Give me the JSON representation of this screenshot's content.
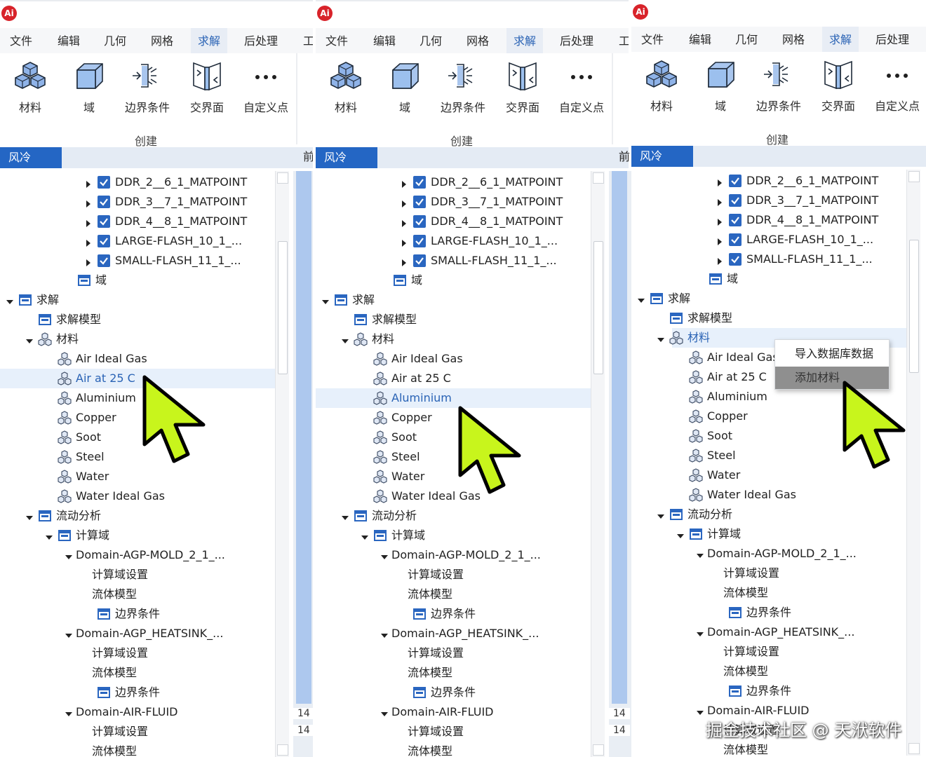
{
  "logo_text": "Ai",
  "menu": [
    "文件",
    "编辑",
    "几何",
    "网格",
    "求解",
    "后处理",
    "工"
  ],
  "active_menu": "求解",
  "ribbon": {
    "buttons": [
      {
        "label": "材料",
        "icon": "material-cubes-icon"
      },
      {
        "label": "域",
        "icon": "domain-box-icon"
      },
      {
        "label": "边界条件",
        "icon": "boundary-condition-icon"
      },
      {
        "label": "交界面",
        "icon": "interface-icon"
      },
      {
        "label": "自定义点",
        "icon": "more-dots-icon"
      }
    ],
    "group_label": "创建"
  },
  "doc_tab": "风冷",
  "side_label": "前",
  "side_numbers": [
    "14",
    "14"
  ],
  "tree": [
    {
      "indent": 4,
      "arrow": "right",
      "icon": "checkbox",
      "text": "DDR_2__6_1_MATPOINT"
    },
    {
      "indent": 4,
      "arrow": "right",
      "icon": "checkbox",
      "text": "DDR_3__7_1_MATPOINT"
    },
    {
      "indent": 4,
      "arrow": "right",
      "icon": "checkbox",
      "text": "DDR_4__8_1_MATPOINT"
    },
    {
      "indent": 4,
      "arrow": "right",
      "icon": "checkbox",
      "text": "LARGE-FLASH_10_1_..."
    },
    {
      "indent": 4,
      "arrow": "right",
      "icon": "checkbox",
      "text": "SMALL-FLASH_11_1_..."
    },
    {
      "indent": 3,
      "arrow": "none",
      "icon": "folder",
      "text": "域"
    },
    {
      "indent": 0,
      "arrow": "down",
      "icon": "folder",
      "text": "求解"
    },
    {
      "indent": 1,
      "arrow": "none",
      "icon": "folder",
      "text": "求解模型"
    },
    {
      "indent": 1,
      "arrow": "down",
      "icon": "material",
      "text": "材料",
      "key": "materials"
    },
    {
      "indent": 2,
      "arrow": "none",
      "icon": "material",
      "text": "Air Ideal Gas"
    },
    {
      "indent": 2,
      "arrow": "none",
      "icon": "material",
      "text": "Air at 25 C",
      "key": "air25"
    },
    {
      "indent": 2,
      "arrow": "none",
      "icon": "material",
      "text": "Aluminium",
      "key": "aluminium"
    },
    {
      "indent": 2,
      "arrow": "none",
      "icon": "material",
      "text": "Copper"
    },
    {
      "indent": 2,
      "arrow": "none",
      "icon": "material",
      "text": "Soot"
    },
    {
      "indent": 2,
      "arrow": "none",
      "icon": "material",
      "text": "Steel"
    },
    {
      "indent": 2,
      "arrow": "none",
      "icon": "material",
      "text": "Water"
    },
    {
      "indent": 2,
      "arrow": "none",
      "icon": "material",
      "text": "Water Ideal Gas"
    },
    {
      "indent": 1,
      "arrow": "down",
      "icon": "folder",
      "text": "流动分析"
    },
    {
      "indent": 2,
      "arrow": "down",
      "icon": "folder",
      "text": "计算域"
    },
    {
      "indent": 3,
      "arrow": "down",
      "icon": "none",
      "text": "Domain-AGP-MOLD_2_1_..."
    },
    {
      "indent": 4,
      "arrow": "none",
      "icon": "none",
      "text": "计算域设置"
    },
    {
      "indent": 4,
      "arrow": "none",
      "icon": "none",
      "text": "流体模型"
    },
    {
      "indent": 4,
      "arrow": "none",
      "icon": "folder",
      "text": "边界条件"
    },
    {
      "indent": 3,
      "arrow": "down",
      "icon": "none",
      "text": "Domain-AGP_HEATSINK_..."
    },
    {
      "indent": 4,
      "arrow": "none",
      "icon": "none",
      "text": "计算域设置"
    },
    {
      "indent": 4,
      "arrow": "none",
      "icon": "none",
      "text": "流体模型"
    },
    {
      "indent": 4,
      "arrow": "none",
      "icon": "folder",
      "text": "边界条件"
    },
    {
      "indent": 3,
      "arrow": "down",
      "icon": "none",
      "text": "Domain-AIR-FLUID"
    },
    {
      "indent": 4,
      "arrow": "none",
      "icon": "none",
      "text": "计算域设置"
    },
    {
      "indent": 4,
      "arrow": "none",
      "icon": "none",
      "text": "流体模型"
    }
  ],
  "panels": [
    {
      "name": "panel-1",
      "highlight": "air25"
    },
    {
      "name": "panel-2",
      "highlight": "aluminium"
    },
    {
      "name": "panel-3",
      "highlight": "materials"
    }
  ],
  "context_menu": {
    "items": [
      "导入数据库数据",
      "添加材料"
    ],
    "hover": "添加材料"
  },
  "watermark": "掘金技术社区 @ 天洑软件",
  "colors": {
    "accent": "#2466c4",
    "cursor": "#c8f51c",
    "cursor_outline": "#000000",
    "checkbox": "#2a66c0"
  }
}
